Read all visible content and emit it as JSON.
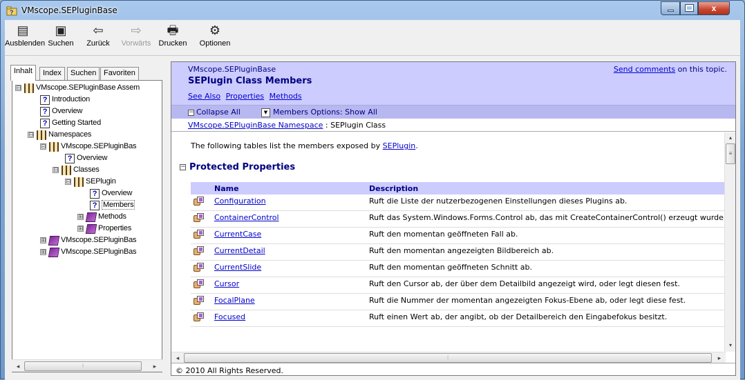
{
  "window": {
    "title": "VMscope.SEPluginBase",
    "controls": {
      "minimize": "–",
      "maximize": "□",
      "close": "x"
    }
  },
  "toolbar": {
    "buttons": [
      {
        "label": "Ausblenden",
        "icon": "hide-pane-icon",
        "glyph": "▤"
      },
      {
        "label": "Suchen",
        "icon": "locate-icon",
        "glyph": "▣"
      },
      {
        "label": "Zurück",
        "icon": "back-arrow-icon",
        "glyph": "⇦"
      },
      {
        "label": "Vorwärts",
        "icon": "forward-arrow-icon",
        "glyph": "⇨",
        "disabled": true
      },
      {
        "label": "Drucken",
        "icon": "print-icon",
        "glyph": "🖶"
      },
      {
        "label": "Optionen",
        "icon": "options-icon",
        "glyph": "⚙"
      }
    ]
  },
  "nav": {
    "tabs": [
      "Inhalt",
      "Index",
      "Suchen",
      "Favoriten"
    ],
    "tree": [
      {
        "label": "VMscope.SEPluginBase Assem",
        "icon": "book-icon",
        "expander": "⊟"
      },
      {
        "label": "Introduction",
        "icon": "help-page-icon"
      },
      {
        "label": "Overview",
        "icon": "help-page-icon"
      },
      {
        "label": "Getting Started",
        "icon": "help-page-icon"
      },
      {
        "label": "Namespaces",
        "icon": "book-icon",
        "expander": "⊟"
      },
      {
        "label": "VMscope.SEPluginBas",
        "icon": "book-icon",
        "expander": "⊟"
      },
      {
        "label": "Overview",
        "icon": "help-page-icon"
      },
      {
        "label": "Classes",
        "icon": "book-icon",
        "expander": "⊟"
      },
      {
        "label": "SEPlugin",
        "icon": "book-icon",
        "expander": "⊟"
      },
      {
        "label": "Overview",
        "icon": "help-page-icon"
      },
      {
        "label": "Members",
        "icon": "help-page-icon",
        "selected": true
      },
      {
        "label": "Methods",
        "icon": "purple-book-icon",
        "expander": "⊞"
      },
      {
        "label": "Properties",
        "icon": "purple-book-icon",
        "expander": "⊞"
      },
      {
        "label": "VMscope.SEPluginBas",
        "icon": "purple-book-icon",
        "expander": "⊞"
      },
      {
        "label": "VMscope.SEPluginBas",
        "icon": "purple-book-icon",
        "expander": "⊞"
      }
    ]
  },
  "content": {
    "namespace_label": "VMscope.SEPluginBase",
    "page_title": "SEPlugin Class Members",
    "comments_link": "Send comments",
    "comments_suffix": " on this topic.",
    "links": [
      "See Also",
      "Properties",
      "Methods"
    ],
    "collapse_all": "Collapse All",
    "members_options": "Members Options: Show All",
    "breadcrumb_link": "VMscope.SEPluginBase Namespace",
    "breadcrumb_suffix": " : SEPlugin Class",
    "intro_prefix": "The following tables list the members exposed by ",
    "intro_link": "SEPlugin",
    "intro_suffix": ".",
    "section_title": "Protected Properties",
    "table_headers": {
      "name": "Name",
      "description": "Description"
    },
    "rows": [
      {
        "name": "Configuration",
        "description": "Ruft die Liste der nutzerbezogenen Einstellungen dieses Plugins ab."
      },
      {
        "name": "ContainerControl",
        "description": "Ruft das System.Windows.Forms.Control ab, das mit CreateContainerControl() erzeugt wurde."
      },
      {
        "name": "CurrentCase",
        "description": "Ruft den momentan geöffneten Fall ab."
      },
      {
        "name": "CurrentDetail",
        "description": "Ruft den momentan angezeigten Bildbereich ab."
      },
      {
        "name": "CurrentSlide",
        "description": "Ruft den momentan geöffneten Schnitt ab."
      },
      {
        "name": "Cursor",
        "description": "Ruft den Cursor ab, der über dem Detailbild angezeigt wird, oder legt diesen fest."
      },
      {
        "name": "FocalPlane",
        "description": "Ruft die Nummer der momentan angezeigten Fokus-Ebene ab, oder legt diese fest."
      },
      {
        "name": "Focused",
        "description": "Ruft einen Wert ab, der angibt, ob der Detailbereich den Eingabefokus besitzt."
      }
    ],
    "footer": "© 2010 All Rights Reserved."
  }
}
